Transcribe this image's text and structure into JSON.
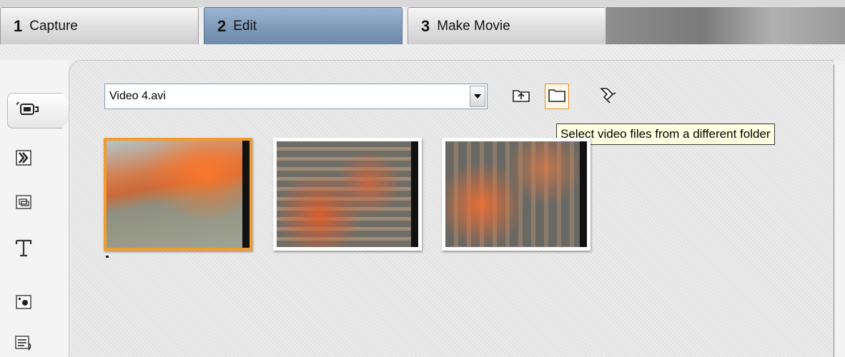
{
  "tabs": [
    {
      "num": "1",
      "label": "Capture"
    },
    {
      "num": "2",
      "label": "Edit"
    },
    {
      "num": "3",
      "label": "Make Movie"
    }
  ],
  "album": {
    "source_value": "Video 4.avi",
    "tooltip": "Select video files from a different folder",
    "clips": [
      {
        "name": "clip-1",
        "selected": true
      },
      {
        "name": "clip-2",
        "selected": false
      },
      {
        "name": "clip-3",
        "selected": false
      }
    ]
  },
  "sidebar_icons": [
    "video-clips-icon",
    "transitions-icon",
    "still-images-icon",
    "titles-icon",
    "sound-effects-icon",
    "menus-icon"
  ],
  "toolbar_icons": [
    "folder-up-icon",
    "folder-icon",
    "scene-detect-icon"
  ],
  "colors": {
    "active_tab": "#7f9ab9",
    "selection": "#f39b2c",
    "tooltip_bg": "#ffffe1"
  }
}
